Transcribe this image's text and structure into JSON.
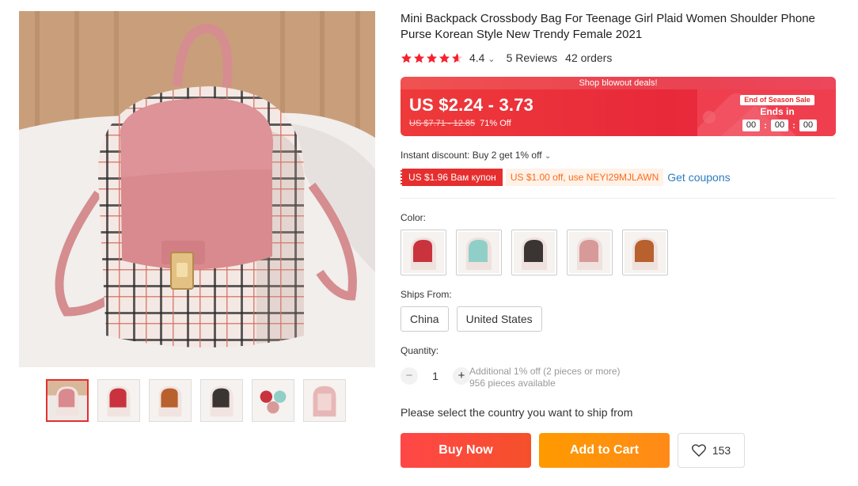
{
  "product": {
    "title": "Mini Backpack Crossbody Bag For Teenage Girl Plaid Women Shoulder Phone Purse Korean Style New Trendy Female 2021",
    "rating": "4.4",
    "rating_caret": "⌄",
    "reviews": "5 Reviews",
    "orders": "42 orders",
    "star_color": "#f5222d"
  },
  "deal": {
    "header": "Shop blowout deals!",
    "price": "US $2.24 - 3.73",
    "old_price": "US $7.71 - 12.85",
    "discount": "71% Off",
    "sale_tag": "End of Season Sale",
    "ends_label": "Ends in",
    "timer": [
      "00",
      "00",
      "00"
    ],
    "accent": "#e8293a"
  },
  "discounts": {
    "instant": "Instant discount: Buy 2 get 1% off",
    "coupon_store": "US $1.96 Вам купон",
    "coupon_code": "US $1.00 off, use NEYI29MJLAWN",
    "get_coupons": "Get coupons"
  },
  "color": {
    "label": "Color:",
    "options": [
      {
        "name": "red",
        "hex": "#c8333d"
      },
      {
        "name": "mint",
        "hex": "#8fcfc8"
      },
      {
        "name": "black",
        "hex": "#3a3432"
      },
      {
        "name": "pink",
        "hex": "#d89a98"
      },
      {
        "name": "brown",
        "hex": "#b8602e"
      }
    ]
  },
  "ships_from": {
    "label": "Ships From:",
    "options": [
      "China",
      "United States"
    ]
  },
  "quantity": {
    "label": "Quantity:",
    "minus": "−",
    "value": "1",
    "plus": "+",
    "additional": "Additional 1% off (2 pieces or more)",
    "available": "956 pieces available"
  },
  "ship_note": "Please select the country you want to ship from",
  "actions": {
    "buy_now": "Buy Now",
    "add_to_cart": "Add to Cart",
    "wishlist_count": "153"
  }
}
